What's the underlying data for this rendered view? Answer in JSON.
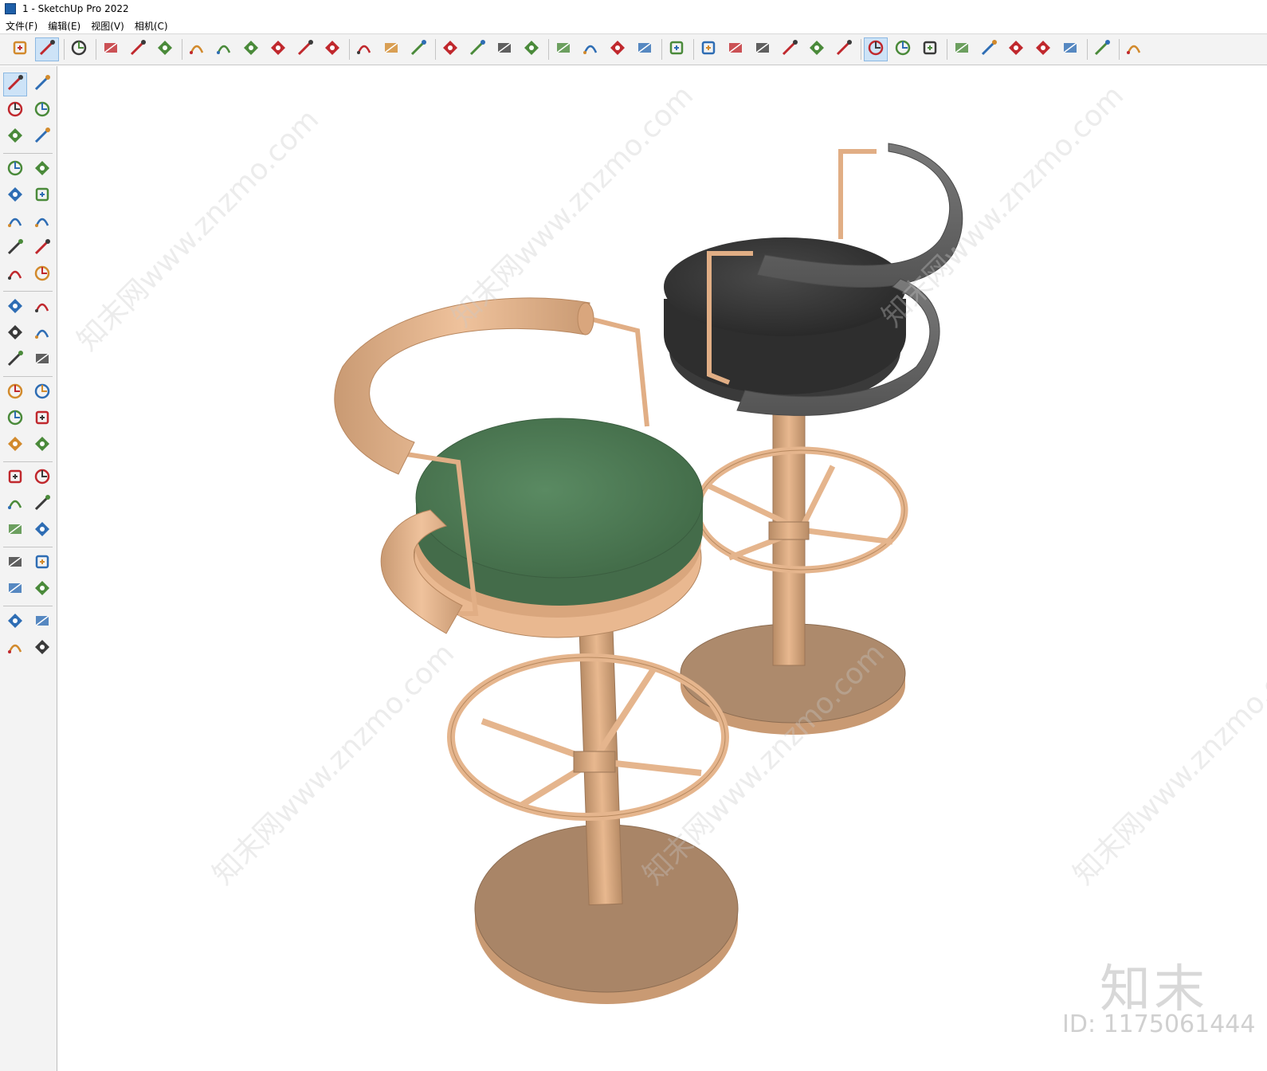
{
  "window": {
    "title": "1 - SketchUp Pro 2022"
  },
  "menu": [
    {
      "label": "文件(F)"
    },
    {
      "label": "编辑(E)"
    },
    {
      "label": "视图(V)"
    },
    {
      "label": "相机(C)"
    }
  ],
  "toolbar": {
    "items": [
      {
        "name": "zoom-icon"
      },
      {
        "name": "select-arrow-icon",
        "active": true
      },
      {
        "name": "eraser-icon"
      },
      {
        "name": "pencil-icon"
      },
      {
        "name": "arc-icon"
      },
      {
        "name": "rectangle-icon"
      },
      {
        "name": "push-pull-icon"
      },
      {
        "name": "follow-me-icon"
      },
      {
        "name": "move-icon"
      },
      {
        "name": "rotate-icon"
      },
      {
        "name": "scale-icon"
      },
      {
        "name": "tape-measure-icon"
      },
      {
        "name": "text-label-icon"
      },
      {
        "name": "paint-bucket-icon"
      },
      {
        "name": "orbit-icon"
      },
      {
        "name": "pan-hand-icon"
      },
      {
        "name": "zoom-magnifier-icon"
      },
      {
        "name": "zoom-extents-icon"
      },
      {
        "name": "warehouse-icon"
      },
      {
        "name": "extension-icon"
      },
      {
        "name": "layers-icon"
      },
      {
        "name": "extension-manager-icon"
      },
      {
        "name": "user-account-icon"
      },
      {
        "name": "iso-view-icon"
      },
      {
        "name": "front-view-icon"
      },
      {
        "name": "home-icon"
      },
      {
        "name": "top-view-icon"
      },
      {
        "name": "right-view-icon"
      },
      {
        "name": "back-view-icon"
      },
      {
        "name": "section-plane-icon"
      },
      {
        "name": "section-display-icon",
        "active": true
      },
      {
        "name": "section-cut-icon"
      },
      {
        "name": "add-icon"
      },
      {
        "name": "solid-icon"
      },
      {
        "name": "styles-icon"
      },
      {
        "name": "texture-checker-icon"
      },
      {
        "name": "cloud-upload-icon"
      },
      {
        "name": "settings-icon"
      },
      {
        "name": "window-icon"
      },
      {
        "name": "info-icon"
      }
    ]
  },
  "left_toolbar": {
    "items": [
      "select-icon",
      "orbit-small-icon",
      "paint-icon",
      "eraser-small-icon",
      "component-icon",
      "tag-icon",
      "pencil-line-icon",
      "freehand-icon",
      "rectangle-small-icon",
      "rotated-rectangle-icon",
      "circle-icon",
      "polygon-icon",
      "arc-small-icon",
      "two-point-arc-icon",
      "three-point-arc-icon",
      "pie-icon",
      "move-small-icon",
      "push-pull-small-icon",
      "rotate-small-icon",
      "follow-me-small-icon",
      "scale-small-icon",
      "offset-icon",
      "tape-small-icon",
      "dimension-icon",
      "protractor-icon",
      "text-small-icon",
      "axes-icon",
      "3d-text-icon",
      "orbit-tool-icon",
      "pan-tool-icon",
      "zoom-tool-icon",
      "zoom-window-icon",
      "zoom-extents-small-icon",
      "previous-view-icon",
      "position-camera-icon",
      "look-around-icon",
      "walk-icon",
      "section-small-icon",
      "warehouse-small-icon",
      "extension-small-icon",
      "layers-small-icon",
      "extension-manager-small-icon"
    ]
  },
  "viewport": {
    "brand": "知末",
    "id_label": "ID: 1175061444",
    "watermark": "知末网www.znzmo.com"
  },
  "colors": {
    "frame": "#e6b58e",
    "frame_dark": "#c99a73",
    "seat_green": "#4f7a55",
    "seat_dark": "#3a3a3a",
    "back_dark": "#6b6b6b",
    "base": "#a98567"
  }
}
